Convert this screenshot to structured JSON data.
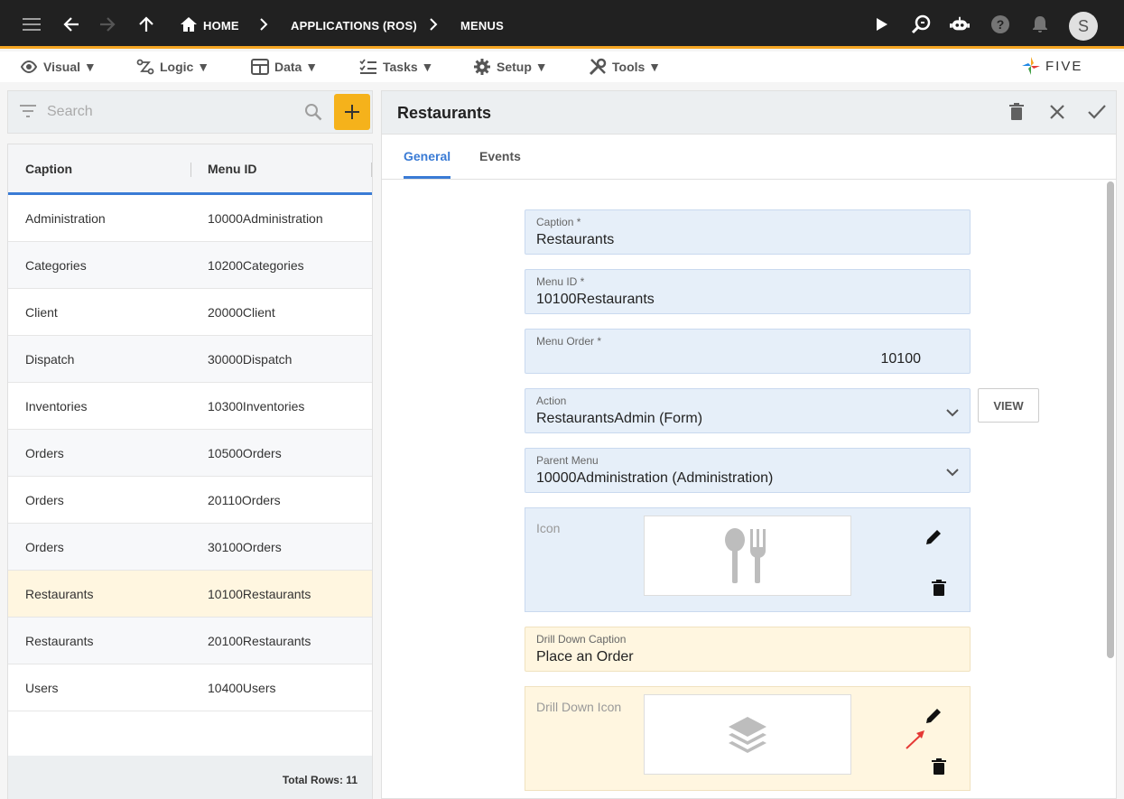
{
  "topbar": {
    "breadcrumb": [
      "HOME",
      "APPLICATIONS (ROS)",
      "MENUS"
    ],
    "avatar_initial": "S"
  },
  "menubar": {
    "items": [
      {
        "label": "Visual ▼",
        "icon": "eye-icon"
      },
      {
        "label": "Logic ▼",
        "icon": "logic-icon"
      },
      {
        "label": "Data ▼",
        "icon": "table-icon"
      },
      {
        "label": "Tasks ▼",
        "icon": "tasks-icon"
      },
      {
        "label": "Setup ▼",
        "icon": "gear-icon"
      },
      {
        "label": "Tools ▼",
        "icon": "tools-icon"
      }
    ],
    "logo": "FIVE"
  },
  "search": {
    "placeholder": "Search"
  },
  "grid": {
    "columns": [
      "Caption",
      "Menu ID"
    ],
    "rows": [
      {
        "caption": "Administration",
        "menu_id": "10000Administration"
      },
      {
        "caption": "Categories",
        "menu_id": "10200Categories"
      },
      {
        "caption": "Client",
        "menu_id": "20000Client"
      },
      {
        "caption": "Dispatch",
        "menu_id": "30000Dispatch"
      },
      {
        "caption": "Inventories",
        "menu_id": "10300Inventories"
      },
      {
        "caption": "Orders",
        "menu_id": "10500Orders"
      },
      {
        "caption": "Orders",
        "menu_id": "20110Orders"
      },
      {
        "caption": "Orders",
        "menu_id": "30100Orders"
      },
      {
        "caption": "Restaurants",
        "menu_id": "10100Restaurants"
      },
      {
        "caption": "Restaurants",
        "menu_id": "20100Restaurants"
      },
      {
        "caption": "Users",
        "menu_id": "10400Users"
      }
    ],
    "selected_index": 8,
    "footer": "Total Rows: 11"
  },
  "form": {
    "title": "Restaurants",
    "tabs": [
      "General",
      "Events"
    ],
    "active_tab": "General",
    "fields": {
      "caption": {
        "label": "Caption *",
        "value": "Restaurants"
      },
      "menu_id": {
        "label": "Menu ID *",
        "value": "10100Restaurants"
      },
      "menu_order": {
        "label": "Menu Order *",
        "value": "10100"
      },
      "action": {
        "label": "Action",
        "value": "RestaurantsAdmin (Form)"
      },
      "parent_menu": {
        "label": "Parent Menu",
        "value": "10000Administration (Administration)"
      },
      "icon": {
        "label": "Icon",
        "image": "cutlery-icon"
      },
      "drill_down_caption": {
        "label": "Drill Down Caption",
        "value": "Place an Order"
      },
      "drill_down_icon": {
        "label": "Drill Down Icon",
        "image": "layers-icon"
      }
    },
    "view_button": "VIEW"
  },
  "colors": {
    "accent": "#3a7bd5",
    "add_button": "#f5b21b",
    "topbar": "#212121",
    "field_bg": "#e6eff9",
    "field_warm_bg": "#fff6e0"
  }
}
